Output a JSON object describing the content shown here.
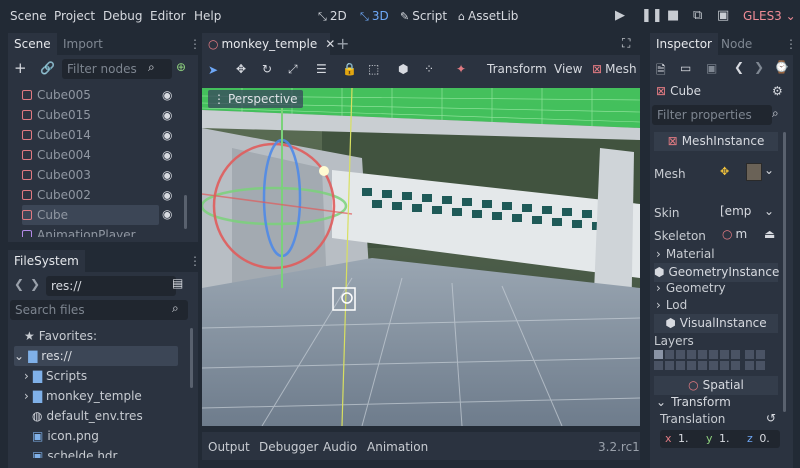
{
  "menu": [
    "Scene",
    "Project",
    "Debug",
    "Editor",
    "Help"
  ],
  "modes": {
    "m2d": "2D",
    "m3d": "3D",
    "script": "Script",
    "assetlib": "AssetLib"
  },
  "renderer": "GLES3",
  "scene_dock": {
    "tabs": [
      "Scene",
      "Import"
    ],
    "filter_placeholder": "Filter nodes",
    "nodes": [
      "Cube005",
      "Cube015",
      "Cube014",
      "Cube004",
      "Cube003",
      "Cube002",
      "Cube",
      "AnimationPlayer"
    ]
  },
  "filesystem": {
    "tab": "FileSystem",
    "path": "res://",
    "search_placeholder": "Search files",
    "favorites": "Favorites:",
    "items": [
      "res://",
      "Scripts",
      "monkey_temple",
      "default_env.tres",
      "icon.png",
      "schelde.hdr"
    ]
  },
  "editor_tabs": {
    "scene_tab": "monkey_temple"
  },
  "toolbar": {
    "transform": "Transform",
    "view": "View",
    "mesh": "Mesh"
  },
  "viewport": {
    "label": "Perspective"
  },
  "bottom_panel": {
    "tabs": [
      "Output",
      "Debugger",
      "Audio",
      "Animation"
    ],
    "version": "3.2.rc1"
  },
  "inspector": {
    "tabs": [
      "Inspector",
      "Node"
    ],
    "object": "Cube",
    "filter_placeholder": "Filter properties",
    "section_mesh_instance": "MeshInstance",
    "mesh_label": "Mesh",
    "skin_label": "Skin",
    "skin_value": "[emp",
    "skeleton_label": "Skeleton",
    "skeleton_value": "m",
    "material": "Material",
    "section_geometry": "GeometryInstance",
    "geometry": "Geometry",
    "lod": "Lod",
    "section_visual": "VisualInstance",
    "layers_label": "Layers",
    "section_spatial": "Spatial",
    "transform": "Transform",
    "translation": "Translation",
    "x_label": "x",
    "x_value": "1.",
    "y_label": "y",
    "y_value": "1.",
    "z_label": "z",
    "z_value": "0."
  },
  "colors": {
    "accent": "#6ea8f7",
    "node_icon": "#e07a82",
    "background": "#222a35",
    "panel": "#2b3340"
  }
}
